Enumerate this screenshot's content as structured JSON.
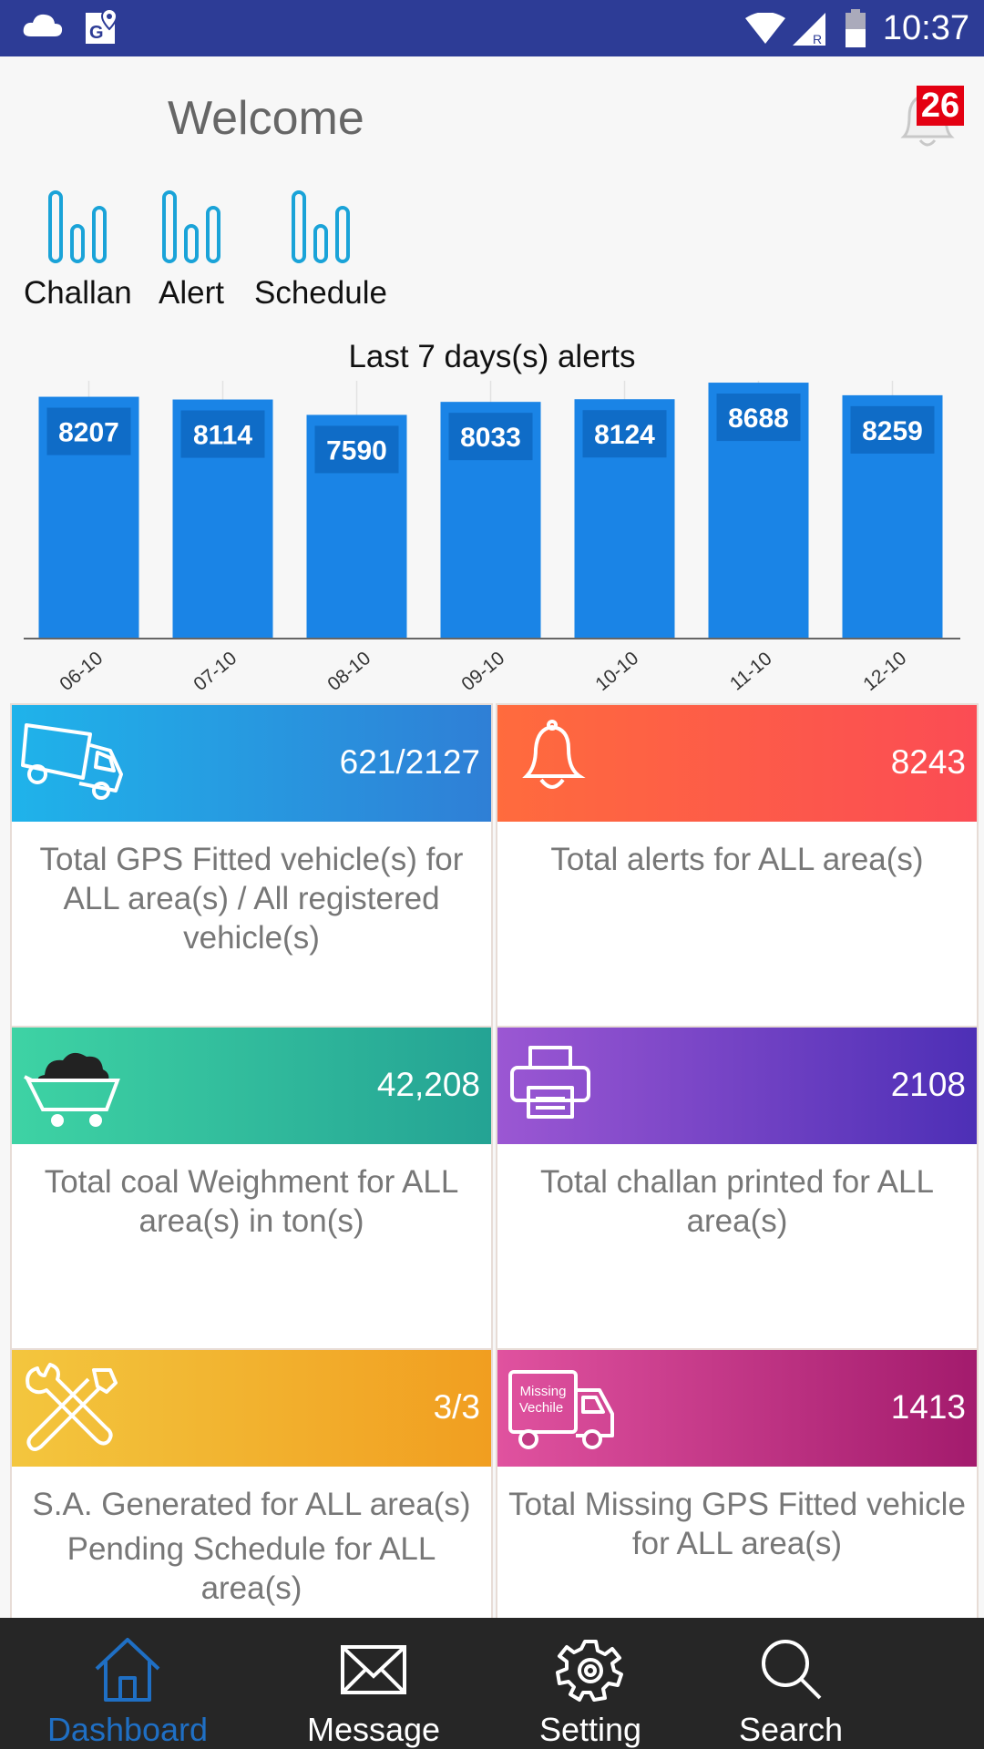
{
  "status_bar": {
    "time": "10:37"
  },
  "header": {
    "welcome": "Welcome",
    "notification_count": "26"
  },
  "shortcuts": [
    {
      "label": "Challan"
    },
    {
      "label": "Alert"
    },
    {
      "label": "Schedule"
    }
  ],
  "chart_data": {
    "type": "bar",
    "title": "Last 7 days(s) alerts",
    "categories": [
      "06-10",
      "07-10",
      "08-10",
      "09-10",
      "10-10",
      "11-10",
      "12-10"
    ],
    "values": [
      8207,
      8114,
      7590,
      8033,
      8124,
      8688,
      8259
    ],
    "bar_color": "#1a84e6",
    "label_bg": "#0f6cc7",
    "ylim": [
      0,
      9000
    ]
  },
  "tiles": [
    {
      "value": "621/2127",
      "description": "Total GPS Fitted vehicle(s) for ALL area(s) / All registered vehicle(s)",
      "icon": "truck-icon",
      "gradient": [
        "#1fb3ea",
        "#2f7fd6"
      ]
    },
    {
      "value": "8243",
      "description": "Total alerts for ALL area(s)",
      "icon": "bell-icon",
      "gradient": [
        "#ff6b3d",
        "#fb4c54"
      ]
    },
    {
      "value": "42,208",
      "description": "Total coal Weighment for ALL area(s) in ton(s)",
      "icon": "coal-cart-icon",
      "gradient": [
        "#3ed3a4",
        "#24a394"
      ]
    },
    {
      "value": "2108",
      "description": "Total challan printed for ALL area(s)",
      "icon": "printer-icon",
      "gradient": [
        "#9b57d3",
        "#4d2fb6"
      ]
    },
    {
      "value": "3/3",
      "description": "S.A. Generated for ALL area(s)",
      "description2": "Pending Schedule for ALL area(s)",
      "icon": "tools-icon",
      "gradient": [
        "#f3c63e",
        "#f19e20"
      ]
    },
    {
      "value": "1413",
      "description": "Total Missing GPS Fitted vehicle for ALL area(s)",
      "icon": "missing-vehicle-icon",
      "icon_text": "Missing Vechile",
      "gradient": [
        "#e0529f",
        "#a31b6d"
      ]
    }
  ],
  "bottom_nav": [
    {
      "label": "Dashboard",
      "icon": "home-icon",
      "active": true
    },
    {
      "label": "Message",
      "icon": "envelope-icon"
    },
    {
      "label": "Setting",
      "icon": "gear-icon"
    },
    {
      "label": "Search",
      "icon": "search-icon"
    }
  ]
}
